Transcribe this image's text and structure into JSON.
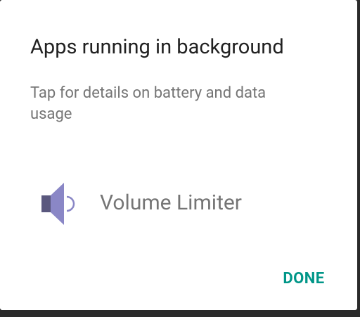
{
  "dialog": {
    "title": "Apps running in background",
    "subtitle": "Tap for details on battery and data usage",
    "apps": [
      {
        "name": "Volume Limiter",
        "icon": "speaker-icon"
      }
    ],
    "done_label": "DONE"
  },
  "colors": {
    "accent": "#009688",
    "icon_body": "#8a87c6",
    "icon_back": "#5a587e"
  }
}
